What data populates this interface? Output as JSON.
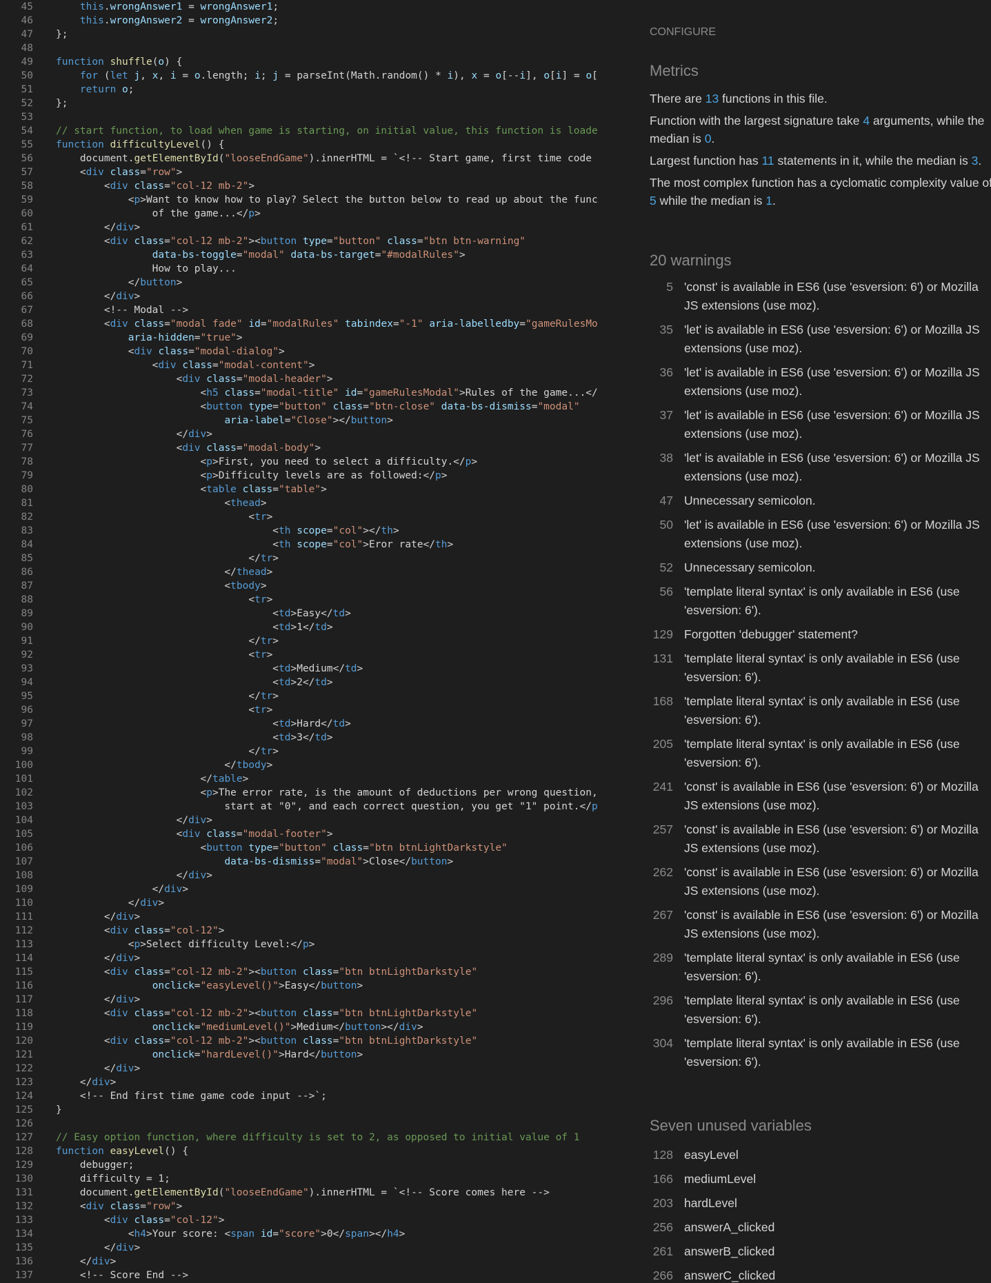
{
  "code": {
    "lines": [
      {
        "n": "45",
        "html": "    <span class=\"kw\">this</span>.<span class=\"var\">wrongAnswer1</span> = <span class=\"var\">wrongAnswer1</span>;"
      },
      {
        "n": "46",
        "html": "    <span class=\"kw\">this</span>.<span class=\"var\">wrongAnswer2</span> = <span class=\"var\">wrongAnswer2</span>;"
      },
      {
        "n": "47",
        "html": "};"
      },
      {
        "n": "48",
        "html": ""
      },
      {
        "n": "49",
        "html": "<span class=\"kw\">function</span> <span class=\"fn\">shuffle</span>(<span class=\"var\">o</span>) {"
      },
      {
        "n": "50",
        "html": "    <span class=\"kw\">for</span> (<span class=\"kw\">let</span> <span class=\"var\">j</span>, <span class=\"var\">x</span>, <span class=\"var\">i</span> = <span class=\"var\">o</span>.length; <span class=\"var\">i</span>; <span class=\"var\">j</span> = parseInt(Math.random() * <span class=\"var\">i</span>), <span class=\"var\">x</span> = <span class=\"var\">o</span>[--<span class=\"var\">i</span>], <span class=\"var\">o</span>[<span class=\"var\">i</span>] = <span class=\"var\">o</span>["
      },
      {
        "n": "51",
        "html": "    <span class=\"kw\">return</span> <span class=\"var\">o</span>;"
      },
      {
        "n": "52",
        "html": "};"
      },
      {
        "n": "53",
        "html": ""
      },
      {
        "n": "54",
        "html": "<span class=\"cm\">// start function, to load when game is starting, on initial value, this function is loade</span>"
      },
      {
        "n": "55",
        "html": "<span class=\"kw\">function</span> <span class=\"fn\">difficultyLevel</span>() {"
      },
      {
        "n": "56",
        "html": "    document.<span class=\"fn\">getElementById</span>(<span class=\"str\">\"looseEndGame\"</span>).innerHTML = `&lt;!-- Start game, first time code"
      },
      {
        "n": "57",
        "html": "    &lt;<span class=\"tag\">div</span> <span class=\"attr\">class</span>=<span class=\"str\">\"row\"</span>&gt;"
      },
      {
        "n": "58",
        "html": "        &lt;<span class=\"tag\">div</span> <span class=\"attr\">class</span>=<span class=\"str\">\"col-12 mb-2\"</span>&gt;"
      },
      {
        "n": "59",
        "html": "            &lt;<span class=\"tag\">p</span>&gt;Want to know how to play? Select the button below to read up about the func"
      },
      {
        "n": "60",
        "html": "                of the game...&lt;/<span class=\"tag\">p</span>&gt;"
      },
      {
        "n": "61",
        "html": "        &lt;/<span class=\"tag\">div</span>&gt;"
      },
      {
        "n": "62",
        "html": "        &lt;<span class=\"tag\">div</span> <span class=\"attr\">class</span>=<span class=\"str\">\"col-12 mb-2\"</span>&gt;&lt;<span class=\"tag\">button</span> <span class=\"attr\">type</span>=<span class=\"str\">\"button\"</span> <span class=\"attr\">class</span>=<span class=\"str\">\"btn btn-warning\"</span>"
      },
      {
        "n": "63",
        "html": "                <span class=\"attr\">data-bs-toggle</span>=<span class=\"str\">\"modal\"</span> <span class=\"attr\">data-bs-target</span>=<span class=\"str\">\"#modalRules\"</span>&gt;"
      },
      {
        "n": "64",
        "html": "                How to play..."
      },
      {
        "n": "65",
        "html": "            &lt;/<span class=\"tag\">button</span>&gt;"
      },
      {
        "n": "66",
        "html": "        &lt;/<span class=\"tag\">div</span>&gt;"
      },
      {
        "n": "67",
        "html": "        &lt;!-- Modal --&gt;"
      },
      {
        "n": "68",
        "html": "        &lt;<span class=\"tag\">div</span> <span class=\"attr\">class</span>=<span class=\"str\">\"modal fade\"</span> <span class=\"attr\">id</span>=<span class=\"str\">\"modalRules\"</span> <span class=\"attr\">tabindex</span>=<span class=\"str\">\"-1\"</span> <span class=\"attr\">aria-labelledby</span>=<span class=\"str\">\"gameRulesMo</span>"
      },
      {
        "n": "69",
        "html": "            <span class=\"attr\">aria-hidden</span>=<span class=\"str\">\"true\"</span>&gt;"
      },
      {
        "n": "70",
        "html": "            &lt;<span class=\"tag\">div</span> <span class=\"attr\">class</span>=<span class=\"str\">\"modal-dialog\"</span>&gt;"
      },
      {
        "n": "71",
        "html": "                &lt;<span class=\"tag\">div</span> <span class=\"attr\">class</span>=<span class=\"str\">\"modal-content\"</span>&gt;"
      },
      {
        "n": "72",
        "html": "                    &lt;<span class=\"tag\">div</span> <span class=\"attr\">class</span>=<span class=\"str\">\"modal-header\"</span>&gt;"
      },
      {
        "n": "73",
        "html": "                        &lt;<span class=\"tag\">h5</span> <span class=\"attr\">class</span>=<span class=\"str\">\"modal-title\"</span> <span class=\"attr\">id</span>=<span class=\"str\">\"gameRulesModal\"</span>&gt;Rules of the game...&lt;/"
      },
      {
        "n": "74",
        "html": "                        &lt;<span class=\"tag\">button</span> <span class=\"attr\">type</span>=<span class=\"str\">\"button\"</span> <span class=\"attr\">class</span>=<span class=\"str\">\"btn-close\"</span> <span class=\"attr\">data-bs-dismiss</span>=<span class=\"str\">\"modal\"</span>"
      },
      {
        "n": "75",
        "html": "                            <span class=\"attr\">aria-label</span>=<span class=\"str\">\"Close\"</span>&gt;&lt;/<span class=\"tag\">button</span>&gt;"
      },
      {
        "n": "76",
        "html": "                    &lt;/<span class=\"tag\">div</span>&gt;"
      },
      {
        "n": "77",
        "html": "                    &lt;<span class=\"tag\">div</span> <span class=\"attr\">class</span>=<span class=\"str\">\"modal-body\"</span>&gt;"
      },
      {
        "n": "78",
        "html": "                        &lt;<span class=\"tag\">p</span>&gt;First, you need to select a difficulty.&lt;/<span class=\"tag\">p</span>&gt;"
      },
      {
        "n": "79",
        "html": "                        &lt;<span class=\"tag\">p</span>&gt;Difficulty levels are as followed:&lt;/<span class=\"tag\">p</span>&gt;"
      },
      {
        "n": "80",
        "html": "                        &lt;<span class=\"tag\">table</span> <span class=\"attr\">class</span>=<span class=\"str\">\"table\"</span>&gt;"
      },
      {
        "n": "81",
        "html": "                            &lt;<span class=\"tag\">thead</span>&gt;"
      },
      {
        "n": "82",
        "html": "                                &lt;<span class=\"tag\">tr</span>&gt;"
      },
      {
        "n": "83",
        "html": "                                    &lt;<span class=\"tag\">th</span> <span class=\"attr\">scope</span>=<span class=\"str\">\"col\"</span>&gt;&lt;/<span class=\"tag\">th</span>&gt;"
      },
      {
        "n": "84",
        "html": "                                    &lt;<span class=\"tag\">th</span> <span class=\"attr\">scope</span>=<span class=\"str\">\"col\"</span>&gt;Eror rate&lt;/<span class=\"tag\">th</span>&gt;"
      },
      {
        "n": "85",
        "html": "                                &lt;/<span class=\"tag\">tr</span>&gt;"
      },
      {
        "n": "86",
        "html": "                            &lt;/<span class=\"tag\">thead</span>&gt;"
      },
      {
        "n": "87",
        "html": "                            &lt;<span class=\"tag\">tbody</span>&gt;"
      },
      {
        "n": "88",
        "html": "                                &lt;<span class=\"tag\">tr</span>&gt;"
      },
      {
        "n": "89",
        "html": "                                    &lt;<span class=\"tag\">td</span>&gt;Easy&lt;/<span class=\"tag\">td</span>&gt;"
      },
      {
        "n": "90",
        "html": "                                    &lt;<span class=\"tag\">td</span>&gt;1&lt;/<span class=\"tag\">td</span>&gt;"
      },
      {
        "n": "91",
        "html": "                                &lt;/<span class=\"tag\">tr</span>&gt;"
      },
      {
        "n": "92",
        "html": "                                &lt;<span class=\"tag\">tr</span>&gt;"
      },
      {
        "n": "93",
        "html": "                                    &lt;<span class=\"tag\">td</span>&gt;Medium&lt;/<span class=\"tag\">td</span>&gt;"
      },
      {
        "n": "94",
        "html": "                                    &lt;<span class=\"tag\">td</span>&gt;2&lt;/<span class=\"tag\">td</span>&gt;"
      },
      {
        "n": "95",
        "html": "                                &lt;/<span class=\"tag\">tr</span>&gt;"
      },
      {
        "n": "96",
        "html": "                                &lt;<span class=\"tag\">tr</span>&gt;"
      },
      {
        "n": "97",
        "html": "                                    &lt;<span class=\"tag\">td</span>&gt;Hard&lt;/<span class=\"tag\">td</span>&gt;"
      },
      {
        "n": "98",
        "html": "                                    &lt;<span class=\"tag\">td</span>&gt;3&lt;/<span class=\"tag\">td</span>&gt;"
      },
      {
        "n": "99",
        "html": "                                &lt;/<span class=\"tag\">tr</span>&gt;"
      },
      {
        "n": "100",
        "html": "                            &lt;/<span class=\"tag\">tbody</span>&gt;"
      },
      {
        "n": "101",
        "html": "                        &lt;/<span class=\"tag\">table</span>&gt;"
      },
      {
        "n": "102",
        "html": "                        &lt;<span class=\"tag\">p</span>&gt;The error rate, is the amount of deductions per wrong question,"
      },
      {
        "n": "103",
        "html": "                            start at \"0\", and each correct question, you get \"1\" point.&lt;/<span class=\"tag\">p</span>"
      },
      {
        "n": "104",
        "html": "                    &lt;/<span class=\"tag\">div</span>&gt;"
      },
      {
        "n": "105",
        "html": "                    &lt;<span class=\"tag\">div</span> <span class=\"attr\">class</span>=<span class=\"str\">\"modal-footer\"</span>&gt;"
      },
      {
        "n": "106",
        "html": "                        &lt;<span class=\"tag\">button</span> <span class=\"attr\">type</span>=<span class=\"str\">\"button\"</span> <span class=\"attr\">class</span>=<span class=\"str\">\"btn btnLightDarkstyle\"</span>"
      },
      {
        "n": "107",
        "html": "                            <span class=\"attr\">data-bs-dismiss</span>=<span class=\"str\">\"modal\"</span>&gt;Close&lt;/<span class=\"tag\">button</span>&gt;"
      },
      {
        "n": "108",
        "html": "                    &lt;/<span class=\"tag\">div</span>&gt;"
      },
      {
        "n": "109",
        "html": "                &lt;/<span class=\"tag\">div</span>&gt;"
      },
      {
        "n": "110",
        "html": "            &lt;/<span class=\"tag\">div</span>&gt;"
      },
      {
        "n": "111",
        "html": "        &lt;/<span class=\"tag\">div</span>&gt;"
      },
      {
        "n": "112",
        "html": "        &lt;<span class=\"tag\">div</span> <span class=\"attr\">class</span>=<span class=\"str\">\"col-12\"</span>&gt;"
      },
      {
        "n": "113",
        "html": "            &lt;<span class=\"tag\">p</span>&gt;Select difficulty Level:&lt;/<span class=\"tag\">p</span>&gt;"
      },
      {
        "n": "114",
        "html": "        &lt;/<span class=\"tag\">div</span>&gt;"
      },
      {
        "n": "115",
        "html": "        &lt;<span class=\"tag\">div</span> <span class=\"attr\">class</span>=<span class=\"str\">\"col-12 mb-2\"</span>&gt;&lt;<span class=\"tag\">button</span> <span class=\"attr\">class</span>=<span class=\"str\">\"btn btnLightDarkstyle\"</span>"
      },
      {
        "n": "116",
        "html": "                <span class=\"attr\">onclick</span>=<span class=\"str\">\"easyLevel()\"</span>&gt;Easy&lt;/<span class=\"tag\">button</span>&gt;"
      },
      {
        "n": "117",
        "html": "        &lt;/<span class=\"tag\">div</span>&gt;"
      },
      {
        "n": "118",
        "html": "        &lt;<span class=\"tag\">div</span> <span class=\"attr\">class</span>=<span class=\"str\">\"col-12 mb-2\"</span>&gt;&lt;<span class=\"tag\">button</span> <span class=\"attr\">class</span>=<span class=\"str\">\"btn btnLightDarkstyle\"</span>"
      },
      {
        "n": "119",
        "html": "                <span class=\"attr\">onclick</span>=<span class=\"str\">\"mediumLevel()\"</span>&gt;Medium&lt;/<span class=\"tag\">button</span>&gt;&lt;/<span class=\"tag\">div</span>&gt;"
      },
      {
        "n": "120",
        "html": "        &lt;<span class=\"tag\">div</span> <span class=\"attr\">class</span>=<span class=\"str\">\"col-12 mb-2\"</span>&gt;&lt;<span class=\"tag\">button</span> <span class=\"attr\">class</span>=<span class=\"str\">\"btn btnLightDarkstyle\"</span>"
      },
      {
        "n": "121",
        "html": "                <span class=\"attr\">onclick</span>=<span class=\"str\">\"hardLevel()\"</span>&gt;Hard&lt;/<span class=\"tag\">button</span>&gt;"
      },
      {
        "n": "122",
        "html": "        &lt;/<span class=\"tag\">div</span>&gt;"
      },
      {
        "n": "123",
        "html": "    &lt;/<span class=\"tag\">div</span>&gt;"
      },
      {
        "n": "124",
        "html": "    &lt;!-- End first time game code input --&gt;`;"
      },
      {
        "n": "125",
        "html": "}"
      },
      {
        "n": "126",
        "html": ""
      },
      {
        "n": "127",
        "html": "<span class=\"cm\">// Easy option function, where difficulty is set to 2, as opposed to initial value of 1</span>"
      },
      {
        "n": "128",
        "html": "<span class=\"kw\">function</span> <span class=\"fn\">easyLevel</span>() {"
      },
      {
        "n": "129",
        "html": "    debugger;"
      },
      {
        "n": "130",
        "html": "    difficulty = 1;"
      },
      {
        "n": "131",
        "html": "    document.<span class=\"fn\">getElementById</span>(<span class=\"str\">\"looseEndGame\"</span>).innerHTML = `&lt;!-- Score comes here --&gt;"
      },
      {
        "n": "132",
        "html": "    &lt;<span class=\"tag\">div</span> <span class=\"attr\">class</span>=<span class=\"str\">\"row\"</span>&gt;"
      },
      {
        "n": "133",
        "html": "        &lt;<span class=\"tag\">div</span> <span class=\"attr\">class</span>=<span class=\"str\">\"col-12\"</span>&gt;"
      },
      {
        "n": "134",
        "html": "            &lt;<span class=\"tag\">h4</span>&gt;Your score: &lt;<span class=\"tag\">span</span> <span class=\"attr\">id</span>=<span class=\"str\">\"score\"</span>&gt;0&lt;/<span class=\"tag\">span</span>&gt;&lt;/<span class=\"tag\">h4</span>&gt;"
      },
      {
        "n": "135",
        "html": "        &lt;/<span class=\"tag\">div</span>&gt;"
      },
      {
        "n": "136",
        "html": "    &lt;/<span class=\"tag\">div</span>&gt;"
      },
      {
        "n": "137",
        "html": "    &lt;!-- Score End --&gt;"
      }
    ]
  },
  "report": {
    "configure": "CONFIGURE",
    "metrics_title": "Metrics",
    "metrics": [
      {
        "html": "There are <span class=\"hl\">13</span> functions in this file."
      },
      {
        "html": "Function with the largest signature take <span class=\"hl\">4</span> arguments, while the median is <span class=\"hl\">0</span>."
      },
      {
        "html": "Largest function has <span class=\"hl\">11</span> statements in it, while the median is <span class=\"hl\">3</span>."
      },
      {
        "html": "The most complex function has a cyclomatic complexity value of <span class=\"hl\">5</span> while the median is <span class=\"hl\">1</span>."
      }
    ],
    "warnings_title": "20 warnings",
    "warnings": [
      {
        "line": "5",
        "text": "'const' is available in ES6 (use 'esversion: 6') or Mozilla JS extensions (use moz)."
      },
      {
        "line": "35",
        "text": "'let' is available in ES6 (use 'esversion: 6') or Mozilla JS extensions (use moz)."
      },
      {
        "line": "36",
        "text": "'let' is available in ES6 (use 'esversion: 6') or Mozilla JS extensions (use moz)."
      },
      {
        "line": "37",
        "text": "'let' is available in ES6 (use 'esversion: 6') or Mozilla JS extensions (use moz)."
      },
      {
        "line": "38",
        "text": "'let' is available in ES6 (use 'esversion: 6') or Mozilla JS extensions (use moz)."
      },
      {
        "line": "47",
        "text": "Unnecessary semicolon."
      },
      {
        "line": "50",
        "text": "'let' is available in ES6 (use 'esversion: 6') or Mozilla JS extensions (use moz)."
      },
      {
        "line": "52",
        "text": "Unnecessary semicolon."
      },
      {
        "line": "56",
        "text": "'template literal syntax' is only available in ES6 (use 'esversion: 6')."
      },
      {
        "line": "129",
        "text": "Forgotten 'debugger' statement?"
      },
      {
        "line": "131",
        "text": "'template literal syntax' is only available in ES6 (use 'esversion: 6')."
      },
      {
        "line": "168",
        "text": "'template literal syntax' is only available in ES6 (use 'esversion: 6')."
      },
      {
        "line": "205",
        "text": "'template literal syntax' is only available in ES6 (use 'esversion: 6')."
      },
      {
        "line": "241",
        "text": "'const' is available in ES6 (use 'esversion: 6') or Mozilla JS extensions (use moz)."
      },
      {
        "line": "257",
        "text": "'const' is available in ES6 (use 'esversion: 6') or Mozilla JS extensions (use moz)."
      },
      {
        "line": "262",
        "text": "'const' is available in ES6 (use 'esversion: 6') or Mozilla JS extensions (use moz)."
      },
      {
        "line": "267",
        "text": "'const' is available in ES6 (use 'esversion: 6') or Mozilla JS extensions (use moz)."
      },
      {
        "line": "289",
        "text": "'template literal syntax' is only available in ES6 (use 'esversion: 6')."
      },
      {
        "line": "296",
        "text": "'template literal syntax' is only available in ES6 (use 'esversion: 6')."
      },
      {
        "line": "304",
        "text": "'template literal syntax' is only available in ES6 (use 'esversion: 6')."
      }
    ],
    "unused_title": "Seven unused variables",
    "unused": [
      {
        "line": "128",
        "name": "easyLevel"
      },
      {
        "line": "166",
        "name": "mediumLevel"
      },
      {
        "line": "203",
        "name": "hardLevel"
      },
      {
        "line": "256",
        "name": "answerA_clicked"
      },
      {
        "line": "261",
        "name": "answerB_clicked"
      },
      {
        "line": "266",
        "name": "answerC_clicked"
      }
    ]
  }
}
